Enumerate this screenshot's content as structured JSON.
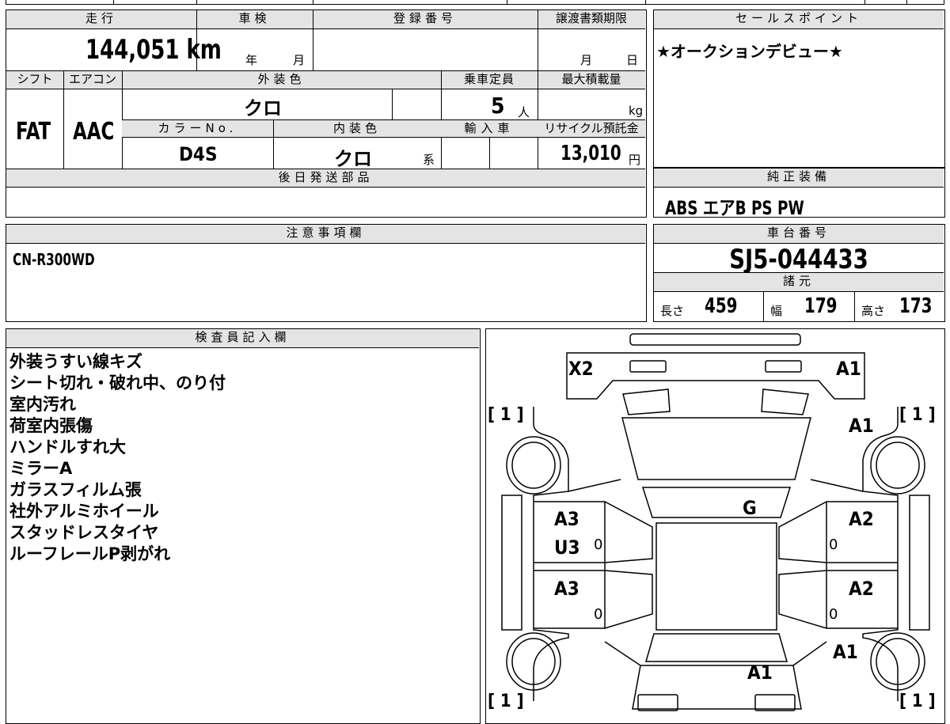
{
  "spec": {
    "mileage_label": "走行",
    "mileage_value": "144,051 km",
    "inspection_label": "車検",
    "inspection_year": "年",
    "inspection_month": "月",
    "registration_label": "登録番号",
    "transfer_label": "譲渡書類期限",
    "transfer_month": "月",
    "transfer_day": "日",
    "shift_label": "シフト",
    "shift_value": "FAT",
    "ac_label": "エアコン",
    "ac_value": "AAC",
    "exterior_label": "外装色",
    "exterior_value": "クロ",
    "capacity_label": "乗車定員",
    "capacity_value": "5",
    "capacity_unit": "人",
    "max_load_label": "最大積載量",
    "max_load_unit": "kg",
    "color_no_label": "カラーNo.",
    "color_no_value": "D4S",
    "interior_label": "内装色",
    "interior_value": "クロ",
    "interior_suffix": "系",
    "import_label": "輸入車",
    "recycle_label": "リサイクル預託金",
    "recycle_value": "13,010",
    "recycle_unit": "円",
    "later_parts_label": "後日発送部品"
  },
  "sales": {
    "label": "セールスポイント",
    "text": "★オークションデビュー★"
  },
  "equipment": {
    "label": "純正装備",
    "text": "ABS エアB PS PW"
  },
  "notes": {
    "label": "注意事項欄",
    "text": "CN-R300WD"
  },
  "chassis": {
    "label": "車台番号",
    "value": "SJ5-044433",
    "dims_label": "諸元",
    "length_label": "長さ",
    "length_value": "459",
    "width_label": "幅",
    "width_value": "179",
    "height_label": "高さ",
    "height_value": "173"
  },
  "inspector": {
    "label": "検査員記入欄",
    "items": [
      "外装うすい線キズ",
      "シート切れ・破れ中、のり付",
      "室内汚れ",
      "荷室内張傷",
      "ハンドルすれ大",
      "ミラーA",
      "ガラスフィルム張",
      "社外アルミホイール",
      "スタッドレスタイヤ",
      "ルーフレールP剥がれ"
    ]
  },
  "diagram": {
    "front_left": "X2",
    "front_right": "A1",
    "fender_right": "A1",
    "roof": "G",
    "front_door_left_1": "A3",
    "front_door_left_2": "U3",
    "rear_door_left": "A3",
    "front_door_right": "A2",
    "rear_door_right": "A2",
    "rear_quarter_right": "A1",
    "rear": "A1",
    "tire_front_left": "[ 1 ]",
    "tire_front_right": "[ 1 ]",
    "tire_rear_left": "[ 1 ]",
    "tire_rear_right": "[ 1 ]",
    "zero": "0"
  }
}
